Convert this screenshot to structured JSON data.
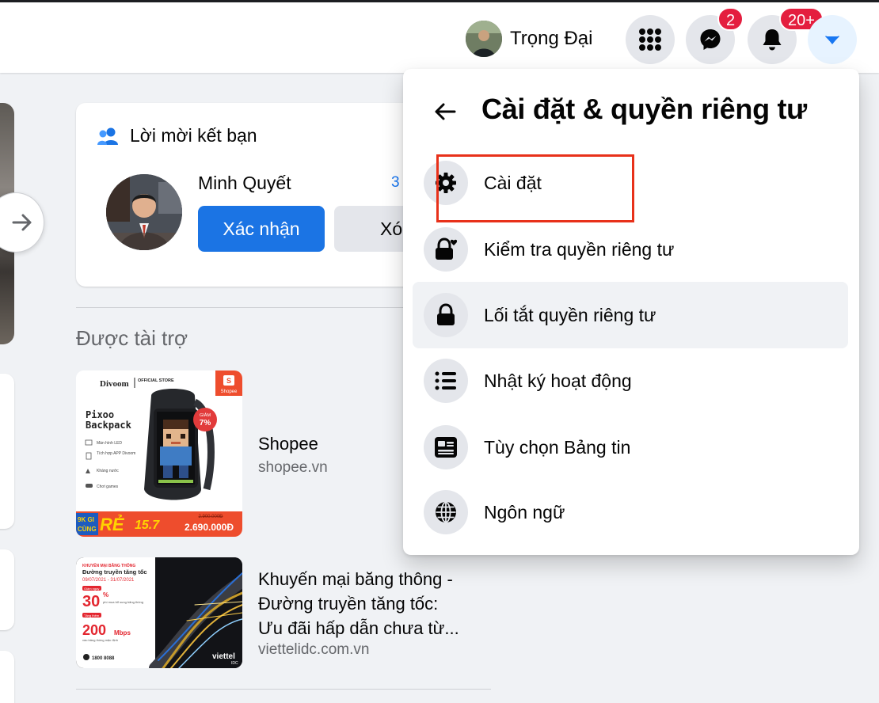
{
  "header": {
    "profile_name": "Trọng Đại",
    "messenger_badge": "2",
    "notifications_badge": "20+"
  },
  "friend_requests": {
    "title": "Lời mời kết bạn",
    "request": {
      "name": "Minh Quyết",
      "mutual": "3",
      "confirm_label": "Xác nhận",
      "delete_label": "Xóa"
    }
  },
  "sponsored": {
    "title": "Được tài trợ",
    "ads": [
      {
        "name": "Shopee",
        "domain": "shopee.vn",
        "image_text": {
          "brand": "Divoom",
          "store": "OFFICIAL STORE",
          "product_line1": "Pixoo",
          "product_line2": "Backpack",
          "features": [
            "Màn hình LED",
            "Tích hợp APP Divoom",
            "Kháng nước",
            "Chơi games"
          ],
          "discount_label": "GIẢM",
          "discount_value": "7%",
          "badge_brand": "Shopee",
          "promo_left_top": "9K GI",
          "promo_left_bottom": "CÙNG",
          "promo_big": "RẺ",
          "promo_date": "15.7",
          "old_price": "2.900.000Đ",
          "new_price": "2.690.000Đ"
        }
      },
      {
        "name_line1": "Khuyến mại băng thông -",
        "name_line2": "Đường truyền tăng tốc:",
        "name_line3": "Ưu đãi hấp dẫn chưa từ...",
        "domain": "viettelidc.com.vn",
        "image_text": {
          "kicker": "KHUYẾN MẠI BĂNG THÔNG",
          "headline": "Đường truyền tăng tốc",
          "dates": "09/07/2021 - 31/07/2021",
          "tag1": "Giảm ngay",
          "value1": "30",
          "unit1": "%",
          "note1": "phí mua bổ sung băng thông",
          "tag2": "Tặng thêm",
          "value2": "200",
          "unit2": "Mbps",
          "note2": "vào băng thông mặc định",
          "hotline": "1800 8088",
          "brand": "viettel",
          "brand_sub": "IDC"
        }
      }
    ]
  },
  "settings_menu": {
    "title": "Cài đặt & quyền riêng tư",
    "items": [
      {
        "label": "Cài đặt",
        "icon": "gear-icon"
      },
      {
        "label": "Kiểm tra quyền riêng tư",
        "icon": "lock-heart-icon"
      },
      {
        "label": "Lối tắt quyền riêng tư",
        "icon": "lock-icon"
      },
      {
        "label": "Nhật ký hoạt động",
        "icon": "list-icon"
      },
      {
        "label": "Tùy chọn Bảng tin",
        "icon": "news-feed-icon"
      },
      {
        "label": "Ngôn ngữ",
        "icon": "globe-icon"
      }
    ]
  },
  "colors": {
    "brand_blue": "#1b74e4",
    "badge_red": "#e41e3f",
    "highlight_red": "#e8311a",
    "shopee_orange": "#ee4d2d"
  }
}
